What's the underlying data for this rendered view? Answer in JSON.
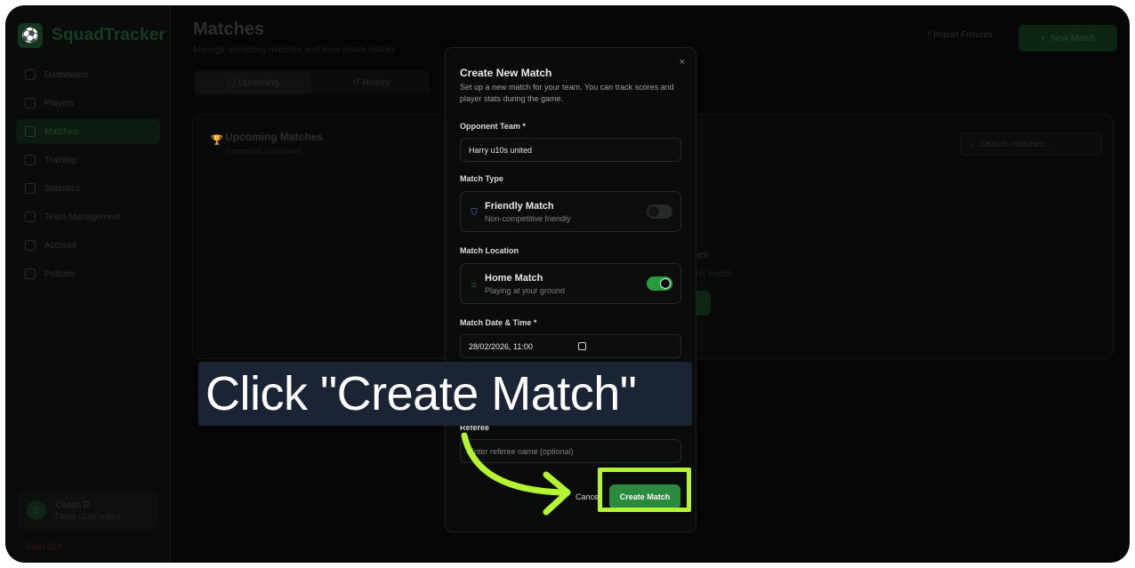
{
  "app": {
    "brand": "SquadTracker",
    "nav": [
      "Dashboard",
      "Players",
      "Matches",
      "Training",
      "Statistics",
      "Team Management",
      "Account",
      "Policies"
    ],
    "active_nav": "Matches",
    "user": {
      "initial": "C",
      "name": "Coach D.",
      "team": "Demo u10s united"
    },
    "sign_out": "Sign Out"
  },
  "page": {
    "title": "Matches",
    "subtitle": "Manage upcoming matches and view match history",
    "import_label": "Import Fixtures",
    "new_match_label": "New Match",
    "tabs": [
      "Upcoming",
      "History"
    ],
    "card_title": "Upcoming Matches",
    "card_count": "0 matches scheduled",
    "search_placeholder": "Search matches...",
    "empty_title": "hes",
    "empty_sub": "first match."
  },
  "modal": {
    "title": "Create New Match",
    "description": "Set up a new match for your team. You can track scores and player stats during the game.",
    "close": "×",
    "opponent_label": "Opponent Team *",
    "opponent_value": "Harry u10s united",
    "match_type_label": "Match Type",
    "match_type": {
      "title": "Friendly Match",
      "subtitle": "Non-competitive friendly",
      "on": false
    },
    "location_label": "Match Location",
    "location": {
      "title": "Home Match",
      "subtitle": "Playing at your ground",
      "on": true
    },
    "datetime_label": "Match Date & Time *",
    "datetime_value": "28/02/2026, 11:00",
    "referee_label": "Referee",
    "referee_placeholder": "Enter referee name (optional)",
    "cancel_label": "Cancel",
    "create_label": "Create Match"
  },
  "tutorial": {
    "caption": "Click \"Create Match\"",
    "highlight_color": "#b3f531"
  },
  "colors": {
    "accent": "#2b8a3e",
    "switch_on": "#2a9a3f"
  }
}
